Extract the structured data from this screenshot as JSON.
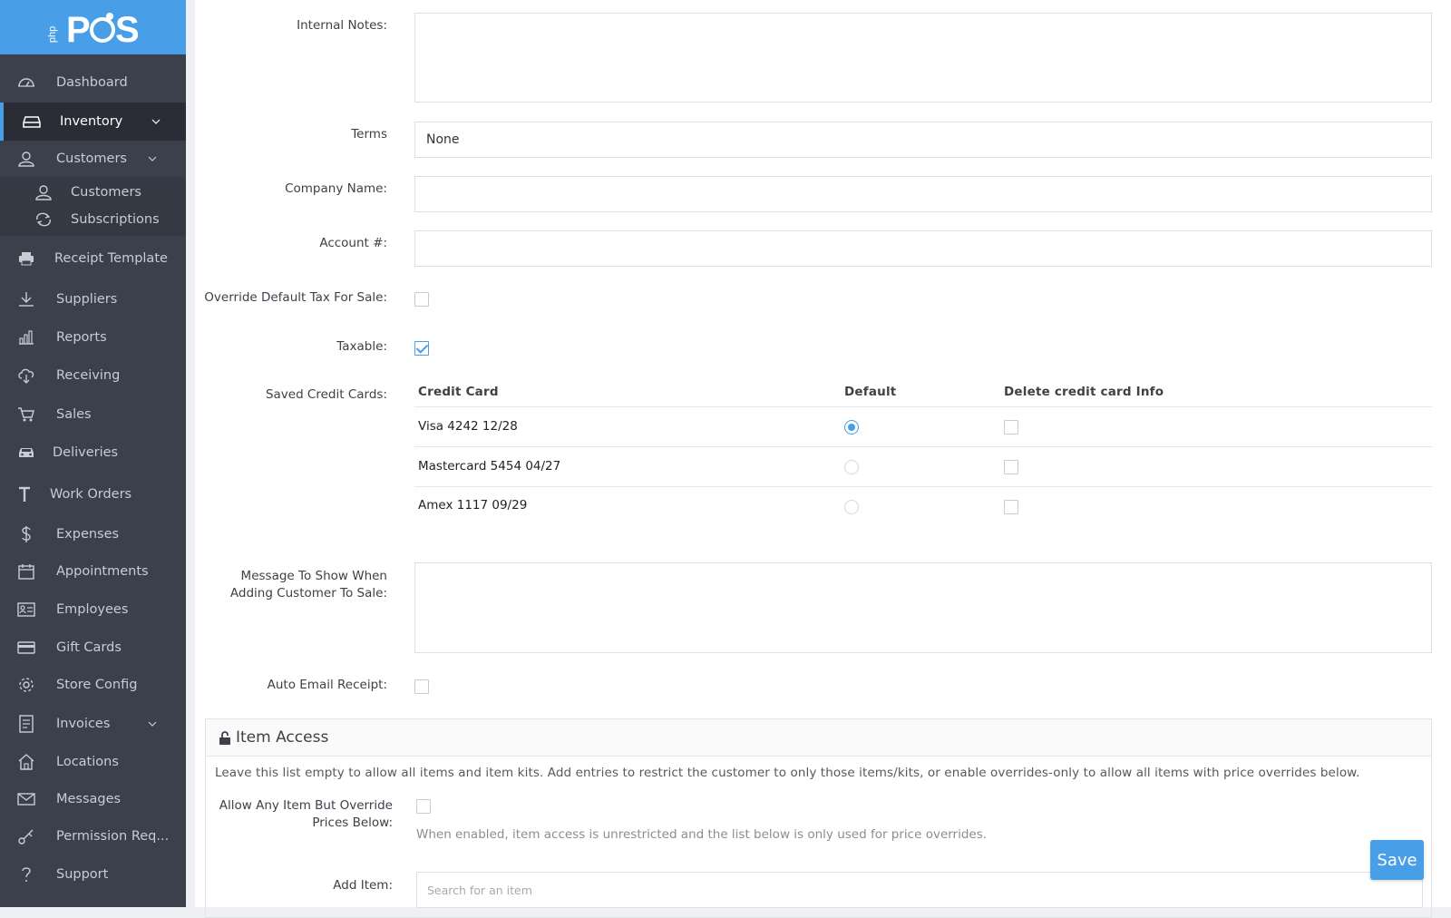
{
  "app": {
    "logo_text": "PHP POS"
  },
  "sidebar": {
    "items": [
      {
        "label": "Dashboard",
        "icon": "dashboard-icon"
      },
      {
        "label": "Inventory",
        "icon": "inventory-icon",
        "active": true
      },
      {
        "label": "Customers",
        "icon": "user-icon"
      },
      {
        "label": "Receipt Template",
        "icon": "printer-icon"
      },
      {
        "label": "Suppliers",
        "icon": "download-icon"
      },
      {
        "label": "Reports",
        "icon": "bar-chart-icon"
      },
      {
        "label": "Receiving",
        "icon": "cloud-download-icon"
      },
      {
        "label": "Sales",
        "icon": "cart-icon"
      },
      {
        "label": "Deliveries",
        "icon": "car-icon"
      },
      {
        "label": "Work Orders",
        "icon": "text-t-icon"
      },
      {
        "label": "Expenses",
        "icon": "dollar-icon"
      },
      {
        "label": "Appointments",
        "icon": "calendar-icon"
      },
      {
        "label": "Employees",
        "icon": "id-card-icon"
      },
      {
        "label": "Gift Cards",
        "icon": "credit-card-icon"
      },
      {
        "label": "Store Config",
        "icon": "gear-icon"
      },
      {
        "label": "Invoices",
        "icon": "invoice-icon"
      },
      {
        "label": "Locations",
        "icon": "home-icon"
      },
      {
        "label": "Messages",
        "icon": "envelope-icon"
      },
      {
        "label": "Permission Req...",
        "icon": "key-icon"
      },
      {
        "label": "Support",
        "icon": "question-icon"
      }
    ],
    "sub_items": [
      {
        "label": "Customers",
        "icon": "user-icon"
      },
      {
        "label": "Subscriptions",
        "icon": "refresh-icon"
      }
    ]
  },
  "form": {
    "internal_notes_label": "Internal Notes:",
    "internal_notes_value": "",
    "terms_label": "Terms",
    "terms_value": "None",
    "company_name_label": "Company Name:",
    "company_name_value": "",
    "account_label": "Account #:",
    "account_value": "",
    "override_tax_label": "Override Default Tax For Sale:",
    "override_tax_checked": false,
    "taxable_label": "Taxable:",
    "taxable_checked": true,
    "saved_cards_label": "Saved Credit Cards:",
    "cards_table": {
      "headers": [
        "Credit Card",
        "Default",
        "Delete credit card Info"
      ],
      "rows": [
        {
          "card": "Visa 4242 12/28",
          "default": true,
          "delete": false
        },
        {
          "card": "Mastercard 5454 04/27",
          "default": false,
          "delete": false
        },
        {
          "card": "Amex 1117 09/29",
          "default": false,
          "delete": false
        }
      ]
    },
    "message_label_line1": "Message To Show When",
    "message_label_line2": "Adding Customer To Sale:",
    "message_value": "",
    "auto_email_label": "Auto Email Receipt:",
    "auto_email_checked": false
  },
  "item_access": {
    "title": "Item Access",
    "description": "Leave this list empty to allow all items and item kits. Add entries to restrict the customer to only those items/kits, or enable overrides-only to allow all items with price overrides below.",
    "allow_any_label_line1": "Allow Any Item But Override",
    "allow_any_label_line2": "Prices Below:",
    "allow_any_checked": false,
    "allow_any_help": "When enabled, item access is unrestricted and the list below is only used for price overrides.",
    "add_item_label": "Add Item:",
    "search_placeholder": "Search for an item"
  },
  "actions": {
    "save_label": "Save"
  },
  "colors": {
    "accent": "#489ee7",
    "sidebar": "#3c404c",
    "sidebar_active": "#2a2d36"
  }
}
